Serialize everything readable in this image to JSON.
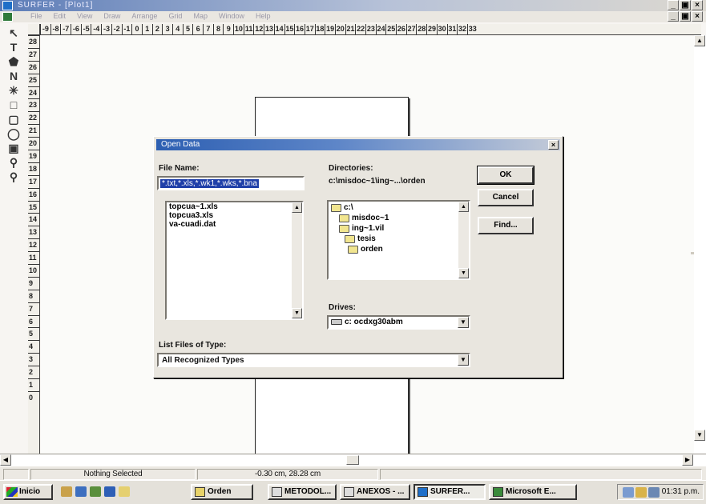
{
  "window": {
    "title": "SURFER - [Plot1]"
  },
  "menu": [
    "File",
    "Edit",
    "View",
    "Draw",
    "Arrange",
    "Grid",
    "Map",
    "Window",
    "Help"
  ],
  "ruler": {
    "horizontal": [
      "-9",
      "-8",
      "-7",
      "-6",
      "-5",
      "-4",
      "-3",
      "-2",
      "-1",
      "0",
      "1",
      "2",
      "3",
      "4",
      "5",
      "6",
      "7",
      "8",
      "9",
      "10",
      "11",
      "12",
      "13",
      "14",
      "15",
      "16",
      "17",
      "18",
      "19",
      "20",
      "21",
      "22",
      "23",
      "24",
      "25",
      "26",
      "27",
      "28",
      "29",
      "30",
      "31",
      "32",
      "33"
    ],
    "vertical": [
      "28",
      "27",
      "26",
      "25",
      "24",
      "23",
      "22",
      "21",
      "20",
      "19",
      "18",
      "17",
      "16",
      "15",
      "14",
      "13",
      "12",
      "11",
      "10",
      "9",
      "8",
      "7",
      "6",
      "5",
      "4",
      "3",
      "2",
      "1",
      "0"
    ]
  },
  "tools": [
    "arrow-tool-icon",
    "text-tool-icon",
    "polygon-tool-icon",
    "polyline-tool-icon",
    "symbol-tool-icon",
    "rectangle-tool-icon",
    "rounded-rectangle-tool-icon",
    "ellipse-tool-icon",
    "reshape-tool-icon",
    "zoom-in-icon",
    "zoom-out-icon"
  ],
  "dialog": {
    "title": "Open Data",
    "file_name_label": "File Name:",
    "file_name_value": "*.txt,*.xls,*.wk1,*.wks,*.bna",
    "files": [
      "topcua~1.xls",
      "topcua3.xls",
      "va-cuadi.dat"
    ],
    "directories_label": "Directories:",
    "current_path": "c:\\misdoc~1\\ing~...\\orden",
    "directories": [
      "c:\\",
      "misdoc~1",
      "ing~1.vil",
      "tesis",
      "orden"
    ],
    "drives_label": "Drives:",
    "drive_value": "c: ocdxg30abm",
    "list_type_label": "List Files of Type:",
    "list_type_value": "All Recognized Types",
    "ok_label": "OK",
    "cancel_label": "Cancel",
    "find_label": "Find..."
  },
  "status": {
    "selection": "Nothing Selected",
    "coords": "-0.30 cm, 28.28 cm"
  },
  "taskbar": {
    "start_label": "Inicio",
    "tasks": [
      "Orden",
      "METODOL...",
      "ANEXOS - ...",
      "SURFER...",
      "Microsoft E..."
    ],
    "clock": "01:31 p.m."
  },
  "colors": {
    "selection": "#1f3fa8",
    "titlebar": "#2d5fb2",
    "folder": "#e8d36a"
  }
}
